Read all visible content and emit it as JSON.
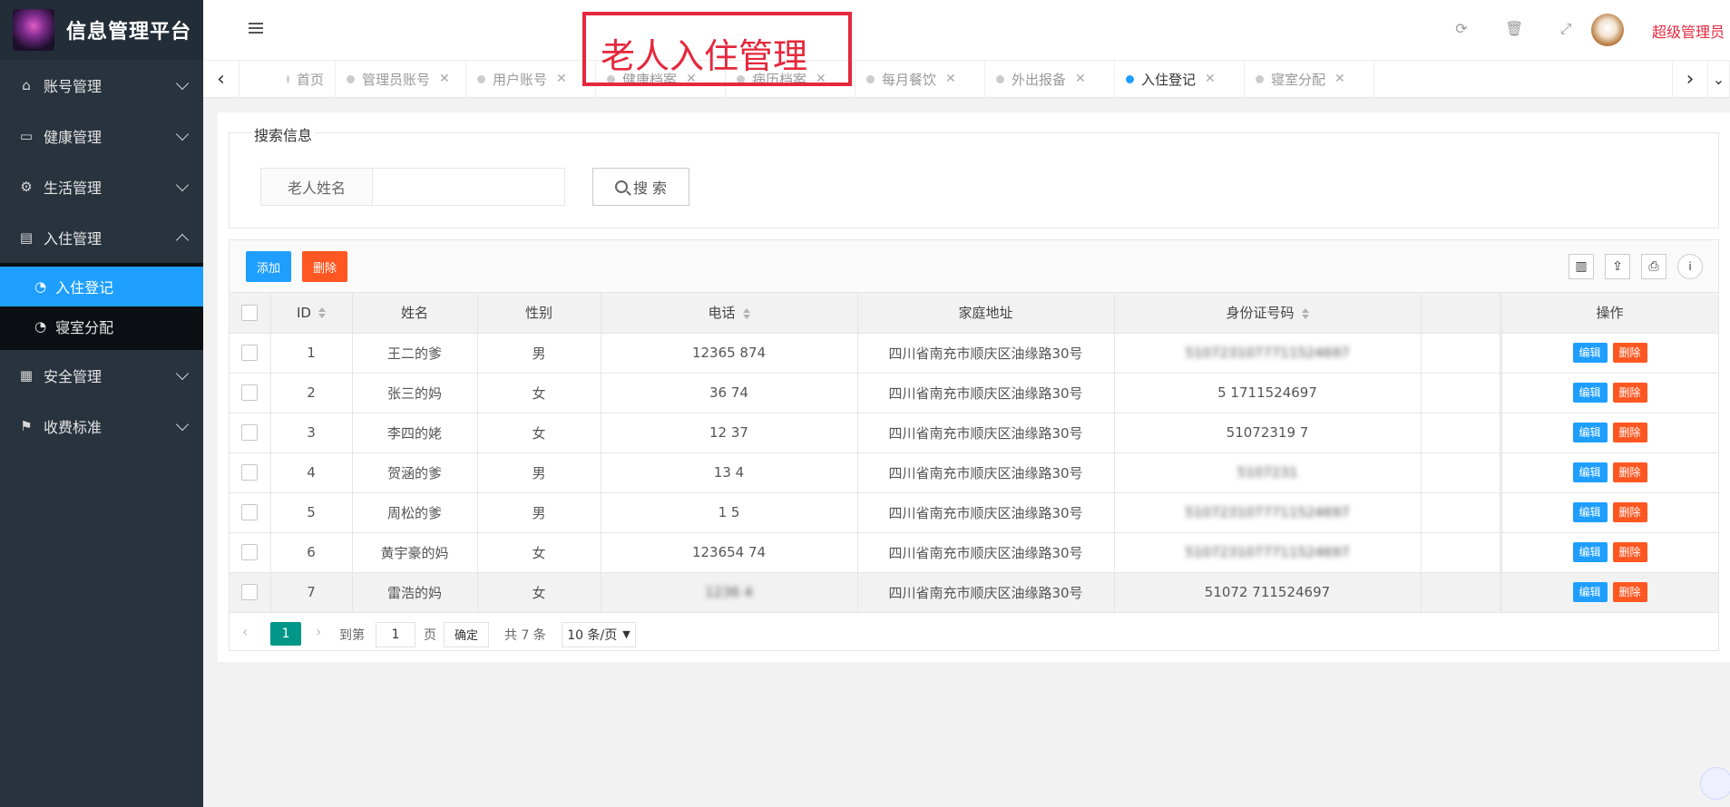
{
  "app": {
    "title": "信息管理平台"
  },
  "page_heading": "老人入住管理",
  "sidebar": {
    "items": [
      {
        "label": "账号管理",
        "icon": "home-icon"
      },
      {
        "label": "健康管理",
        "icon": "window-icon"
      },
      {
        "label": "生活管理",
        "icon": "gears-icon"
      },
      {
        "label": "入住管理",
        "icon": "document-icon"
      },
      {
        "label": "安全管理",
        "icon": "calendar-icon"
      },
      {
        "label": "收费标准",
        "icon": "flag-icon"
      }
    ],
    "sub": [
      {
        "label": "入住登记",
        "icon": "dashboard-icon"
      },
      {
        "label": "寝室分配",
        "icon": "dashboard-icon"
      }
    ]
  },
  "header": {
    "user": "超级管理员"
  },
  "tabs": [
    "首页",
    "管理员账号",
    "用户账号",
    "健康档案",
    "病历档案",
    "每月餐饮",
    "外出报备",
    "入住登记",
    "寝室分配"
  ],
  "search": {
    "legend": "搜索信息",
    "label": "老人姓名",
    "value": "",
    "button": "搜 索"
  },
  "toolbar": {
    "add": "添加",
    "delete": "删除"
  },
  "table": {
    "columns": [
      "ID",
      "姓名",
      "性别",
      "电话",
      "家庭地址",
      "身份证号码",
      "操作"
    ],
    "rows": [
      {
        "id": "1",
        "name": "王二的爹",
        "sex": "男",
        "phone": "12365 874",
        "addr": "四川省南充市顺庆区油缘路30号",
        "idcard": "5107231077711524697"
      },
      {
        "id": "2",
        "name": "张三的妈",
        "sex": "女",
        "phone": "36 74",
        "addr": "四川省南充市顺庆区油缘路30号",
        "idcard": "5 1711524697"
      },
      {
        "id": "3",
        "name": "李四的姥",
        "sex": "女",
        "phone": "12 37",
        "addr": "四川省南充市顺庆区油缘路30号",
        "idcard": "51072319 7"
      },
      {
        "id": "4",
        "name": "贺涵的爹",
        "sex": "男",
        "phone": "13 4",
        "addr": "四川省南充市顺庆区油缘路30号",
        "idcard": "5107231"
      },
      {
        "id": "5",
        "name": "周松的爹",
        "sex": "男",
        "phone": "1 5",
        "addr": "四川省南充市顺庆区油缘路30号",
        "idcard": "5107231077711524697"
      },
      {
        "id": "6",
        "name": "黄宇豪的妈",
        "sex": "女",
        "phone": "123654 74",
        "addr": "四川省南充市顺庆区油缘路30号",
        "idcard": "5107231077711524697"
      },
      {
        "id": "7",
        "name": "雷浩的妈",
        "sex": "女",
        "phone": "1236 4",
        "addr": "四川省南充市顺庆区油缘路30号",
        "idcard": "51072 711524697"
      }
    ],
    "actions": {
      "edit": "编辑",
      "delete": "删除"
    }
  },
  "pager": {
    "current": "1",
    "goto": "到第",
    "page_value": "1",
    "page_unit": "页",
    "confirm": "确定",
    "total": "共 7 条",
    "size": "10 条/页"
  }
}
